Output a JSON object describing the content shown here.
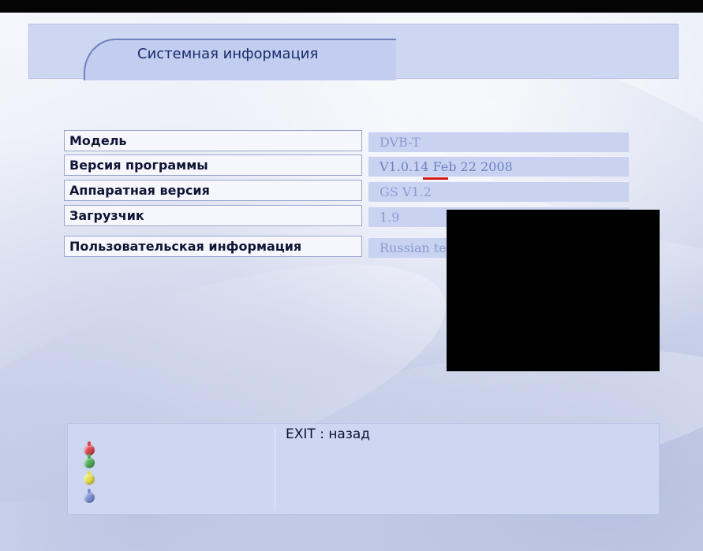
{
  "header": {
    "title": "Системная информация"
  },
  "info_rows": [
    {
      "label": "Модель",
      "value": "DVB-T"
    },
    {
      "label": "Версия программы",
      "value": "V1.0.14 Feb 22 2008"
    },
    {
      "label": "Аппаратная версия",
      "value": "GS V1.2"
    },
    {
      "label": "Загрузчик",
      "value": "1.9"
    },
    {
      "label": "Пользовательская информация",
      "value": "Russian terrestrial network"
    }
  ],
  "help": {
    "exit_text": "EXIT : назад",
    "color_buttons": [
      {
        "icon": "red-button-icon",
        "color": "#d9444f"
      },
      {
        "icon": "green-button-icon",
        "color": "#4fae55"
      },
      {
        "icon": "yellow-button-icon",
        "color": "#e5dc4a"
      },
      {
        "icon": "blue-button-icon",
        "color": "#7d8fd6"
      }
    ]
  },
  "colors": {
    "panel": "#cdd7f2",
    "label_bg": "#f6f7fc",
    "value_text": "#8d99d2",
    "title_text": "#1a2a6a"
  }
}
